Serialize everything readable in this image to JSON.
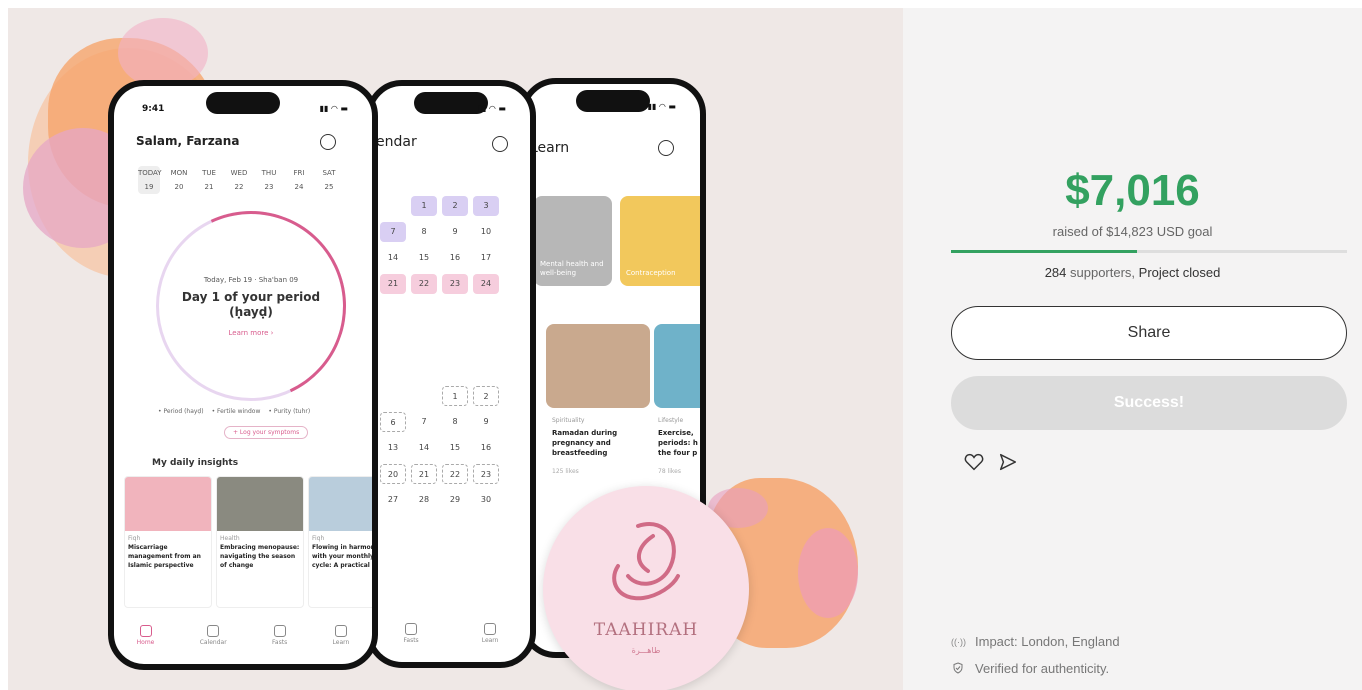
{
  "promo": {
    "phone1": {
      "time": "9:41",
      "greeting": "Salam, Farzana",
      "week_days": [
        "TODAY",
        "MON",
        "TUE",
        "WED",
        "THU",
        "FRI",
        "SAT"
      ],
      "week_dates": [
        "19",
        "20",
        "21",
        "22",
        "23",
        "24",
        "25"
      ],
      "dial_sub": "Today, Feb 19 · Sha'ban 09",
      "dial_main": "Day 1 of your period (ḥayḍ)",
      "dial_link": "Learn more ›",
      "legend": [
        "• Period (hayḍ)",
        "• Fertile window",
        "• Purity (tuhr)"
      ],
      "log": "+ Log your symptoms",
      "insights_title": "My daily insights",
      "cards": [
        {
          "cat": "Fiqh",
          "title": "Miscarriage management from an Islamic perspective"
        },
        {
          "cat": "Health",
          "title": "Embracing menopause: navigating the season of change"
        },
        {
          "cat": "Fiqh",
          "title": "Flowing in harmony with your monthly cycle: A practical guide"
        }
      ],
      "tabs": [
        "Home",
        "Calendar",
        "Fasts",
        "Learn"
      ]
    },
    "phone2": {
      "title": "endar",
      "tabs": [
        "Fasts",
        "Learn"
      ]
    },
    "phone3": {
      "title": "Learn",
      "card1": "Mental health and well-being",
      "card2": "Contraception",
      "card3_cat": "Spirituality",
      "card3_title": "Ramadan during pregnancy and breastfeeding",
      "card3_likes": "125 likes",
      "card4_cat": "Lifestyle",
      "card4_title": "Exercise, periods: h the four p",
      "card4_likes": "78 likes"
    },
    "logo": {
      "name": "TAAHIRAH",
      "sub": "طاهـــرة"
    }
  },
  "panel": {
    "amount": "$7,016",
    "goal_text": "raised of $14,823 USD goal",
    "progress": 0.47,
    "supporters_count": "284",
    "supporters_label": " supporters, ",
    "status": "Project closed",
    "share_label": "Share",
    "success_label": "Success!",
    "impact": "Impact: London, England",
    "verified": "Verified for authenticity.",
    "colors": {
      "accent": "#33a160",
      "button_disabled": "#dcdcdc"
    }
  }
}
